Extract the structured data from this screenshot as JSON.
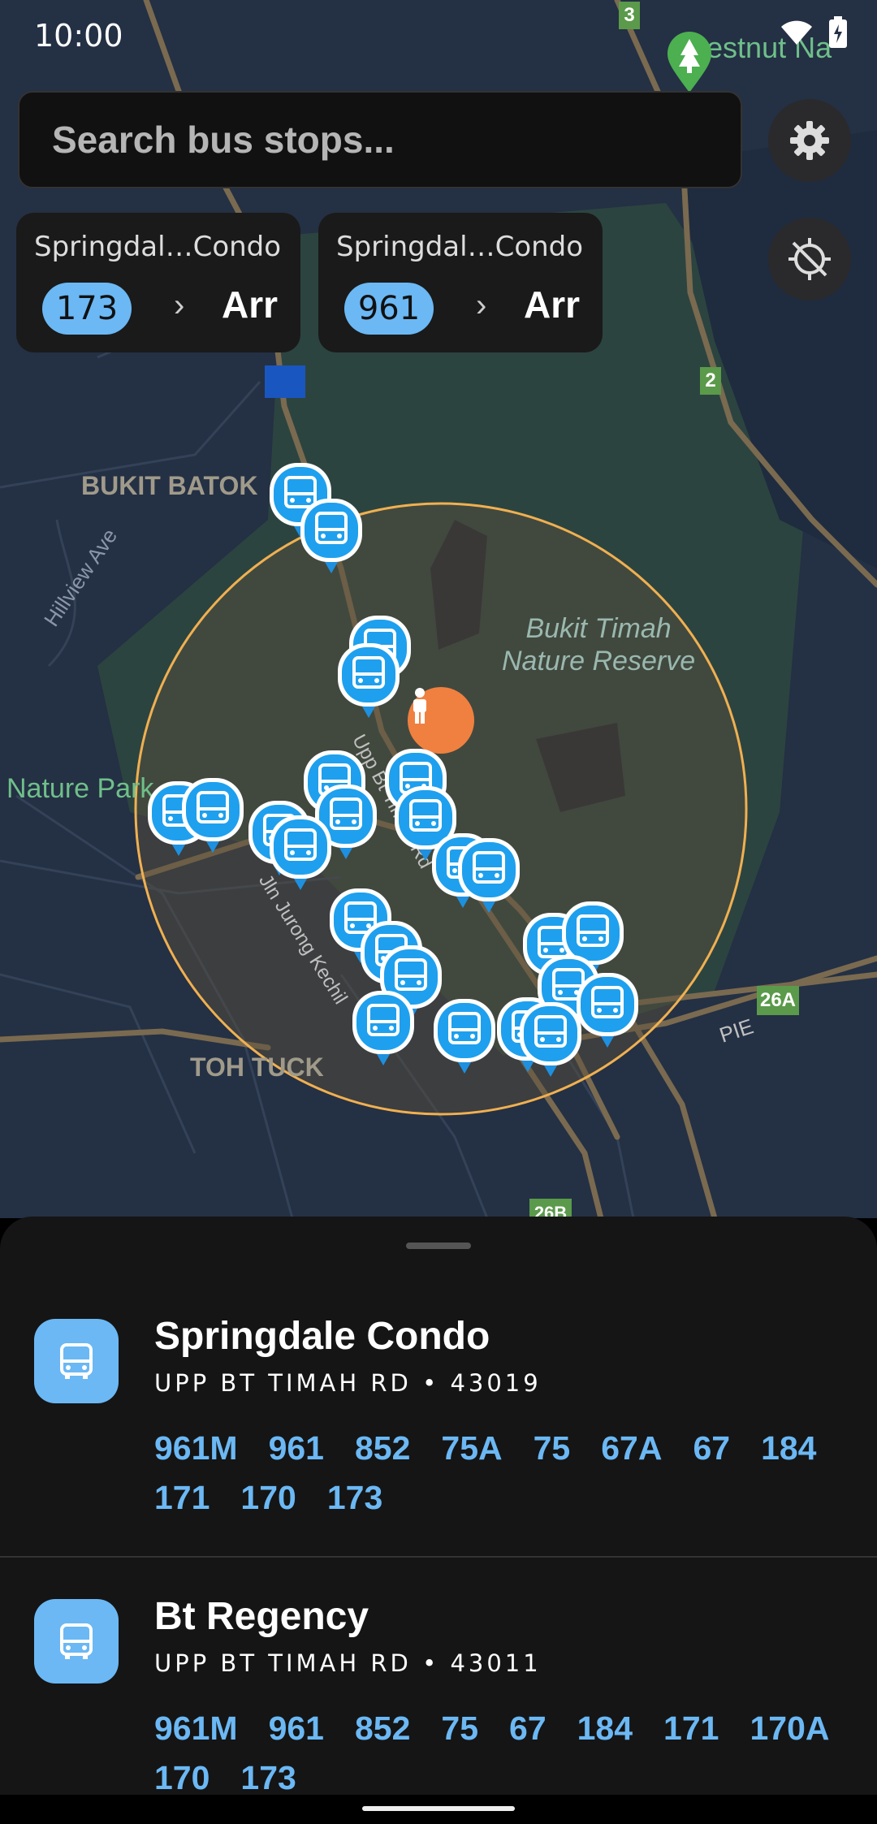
{
  "status_bar": {
    "time": "10:00"
  },
  "search": {
    "placeholder": "Search bus stops..."
  },
  "favorites": [
    {
      "stop_name": "Springdal…Condo",
      "service": "173",
      "arrival": "Arr"
    },
    {
      "stop_name": "Springdal…Condo",
      "service": "961",
      "arrival": "Arr"
    }
  ],
  "map": {
    "labels": {
      "chestnut": "Chestnut Na",
      "bukit_batok": "BUKIT BATOK",
      "hillview": "Hillview Ave",
      "reserve_line1": "Bukit Timah",
      "reserve_line2": "Nature Reserve",
      "nature_park": "Nature Park",
      "upp_bt_timah": "Upp Bt Timah Rd",
      "jln_jurong": "Jln Jurong Kechil",
      "toh_tuck": "TOH TUCK",
      "pie": "PIE"
    },
    "route_shields": [
      "3",
      "2",
      "26A",
      "26B"
    ]
  },
  "bus_stops": [
    {
      "name": "Springdale Condo",
      "road": "UPP BT TIMAH RD",
      "code": "43019",
      "separator": "•",
      "services": [
        "961M",
        "961",
        "852",
        "75A",
        "75",
        "67A",
        "67",
        "184",
        "171",
        "170",
        "173"
      ]
    },
    {
      "name": "Bt Regency",
      "road": "UPP BT TIMAH RD",
      "code": "43011",
      "separator": "•",
      "services": [
        "961M",
        "961",
        "852",
        "75",
        "67",
        "184",
        "171",
        "170A",
        "170",
        "173"
      ]
    }
  ],
  "colors": {
    "accent": "#6bb8f4",
    "map_bg": "#243044",
    "radius_ring": "#f0b050",
    "user_marker": "#f08040"
  },
  "icons": [
    "settings-gear-icon",
    "location-off-icon",
    "bus-icon",
    "person-icon",
    "tree-pin-icon",
    "wifi-icon",
    "battery-icon"
  ]
}
